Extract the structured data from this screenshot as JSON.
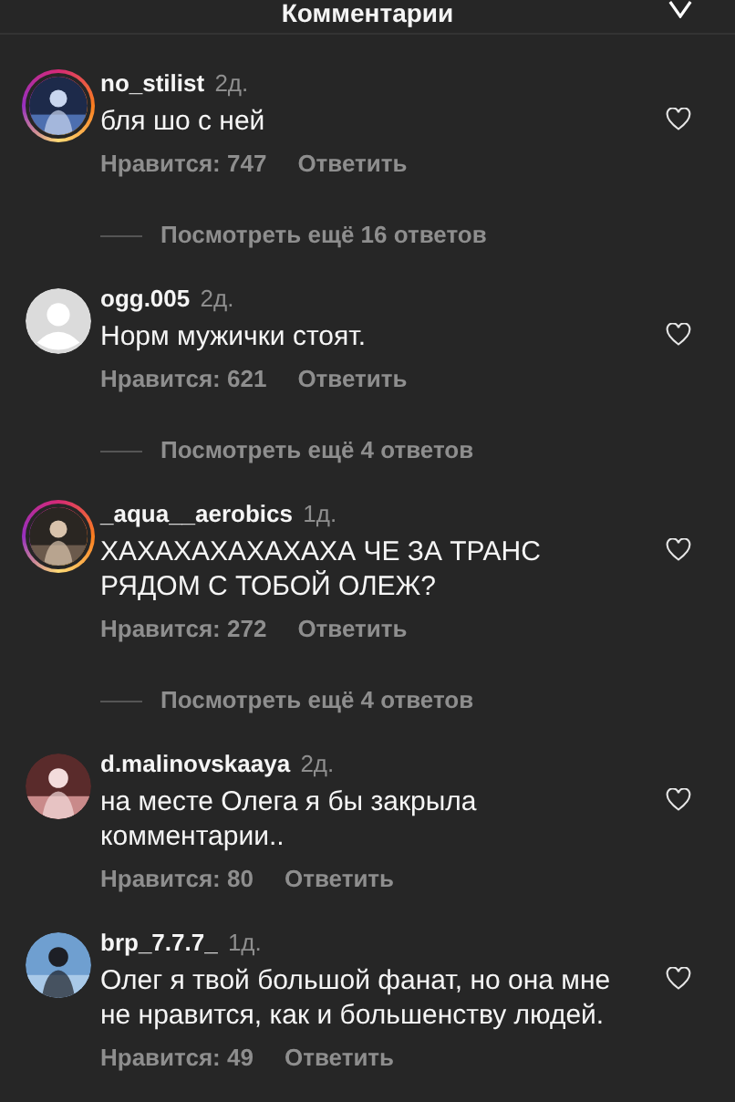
{
  "header": {
    "title": "Комментарии"
  },
  "comments": [
    {
      "username": "no_stilist",
      "time": "2д.",
      "text": "бля шо с ней",
      "likes": "Нравится: 747",
      "reply": "Ответить",
      "avatar": {
        "kind": "picture",
        "story_ring": true
      },
      "liked": false,
      "more_replies": "Посмотреть ещё 16 ответов"
    },
    {
      "username": "ogg.005",
      "time": "2д.",
      "text": "Норм мужички стоят.",
      "likes": "Нравится: 621",
      "reply": "Ответить",
      "avatar": {
        "kind": "default",
        "story_ring": false
      },
      "liked": false,
      "more_replies": "Посмотреть ещё 4 ответов"
    },
    {
      "username": "_aqua__aerobics",
      "time": "1д.",
      "text": "ХАХАХАХАХАХАХА ЧЕ ЗА ТРАНС РЯДОМ С ТОБОЙ ОЛЕЖ?",
      "likes": "Нравится: 272",
      "reply": "Ответить",
      "avatar": {
        "kind": "picture",
        "story_ring": true
      },
      "liked": false,
      "more_replies": "Посмотреть ещё 4 ответов"
    },
    {
      "username": "d.malinovskaaya",
      "time": "2д.",
      "text": "на месте Олега я бы закрыла комментарии..",
      "likes": "Нравится: 80",
      "reply": "Ответить",
      "avatar": {
        "kind": "picture",
        "story_ring": false
      },
      "liked": false
    },
    {
      "username": "brp_7.7.7_",
      "time": "1д.",
      "text": "Олег я твой большой фанат, но она мне не нравится, как и большенству людей.",
      "likes": "Нравится: 49",
      "reply": "Ответить",
      "avatar": {
        "kind": "picture",
        "story_ring": false
      },
      "liked": false
    }
  ]
}
